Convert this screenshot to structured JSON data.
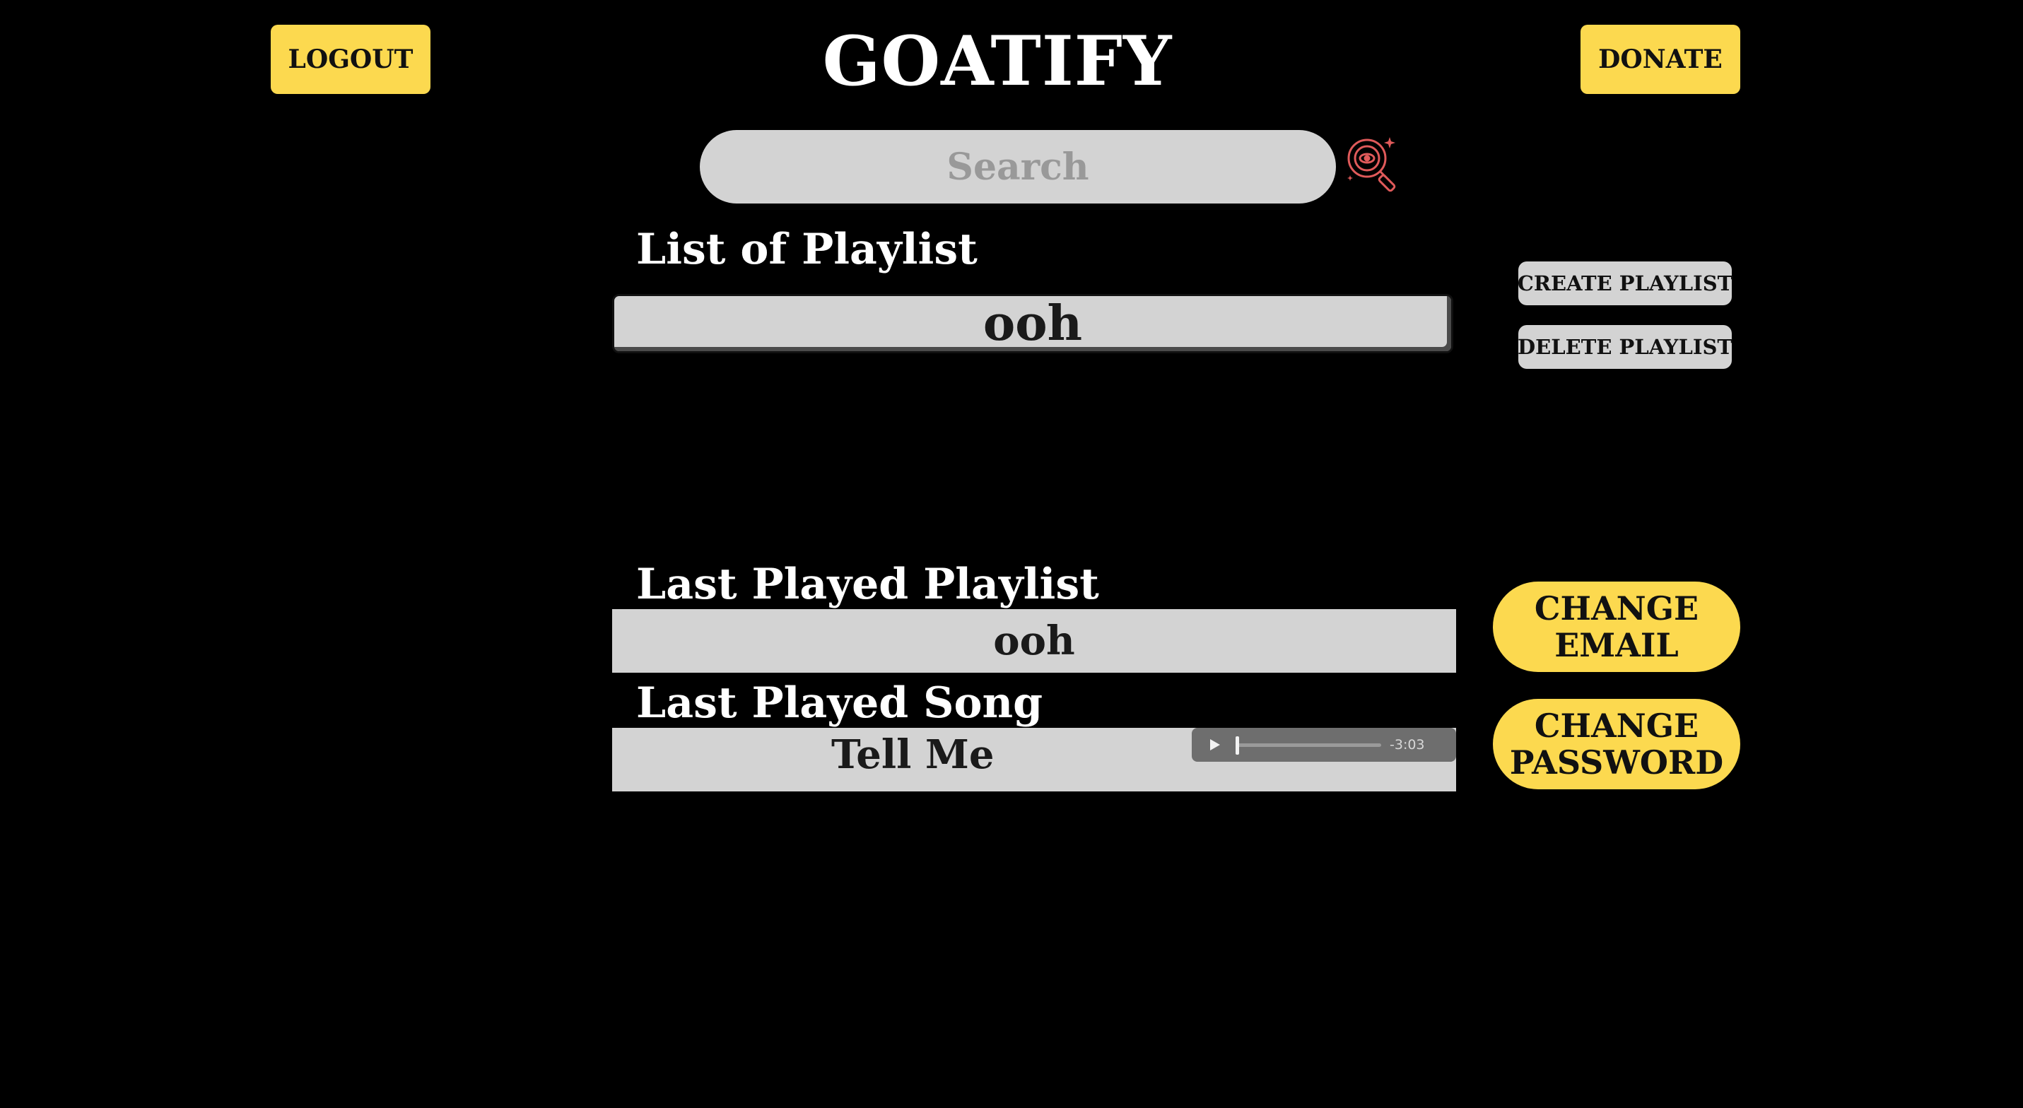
{
  "header": {
    "title": "GOATIFY",
    "logout_label": "LOGOUT",
    "donate_label": "DONATE"
  },
  "search": {
    "placeholder": "Search",
    "value": "",
    "icon": "vinyl-search-icon"
  },
  "playlists": {
    "heading": "List of Playlist",
    "items": [
      {
        "label": "ooh"
      }
    ],
    "create_label": "CREATE PLAYLIST",
    "delete_label": "DELETE PLAYLIST"
  },
  "last_played_playlist": {
    "heading": "Last Played Playlist",
    "value": "ooh"
  },
  "last_played_song": {
    "heading": "Last Played Song",
    "value": "Tell Me",
    "player": {
      "play_icon": "play-icon",
      "time_remaining": "-3:03",
      "progress": 0
    }
  },
  "account": {
    "change_email_line1": "CHANGE",
    "change_email_line2": "EMAIL",
    "change_password_line1": "CHANGE",
    "change_password_line2": "PASSWORD"
  },
  "colors": {
    "background": "#000000",
    "accent_yellow": "#fcd94f",
    "panel_gray": "#d3d3d3",
    "icon_red": "#e05a5a"
  }
}
